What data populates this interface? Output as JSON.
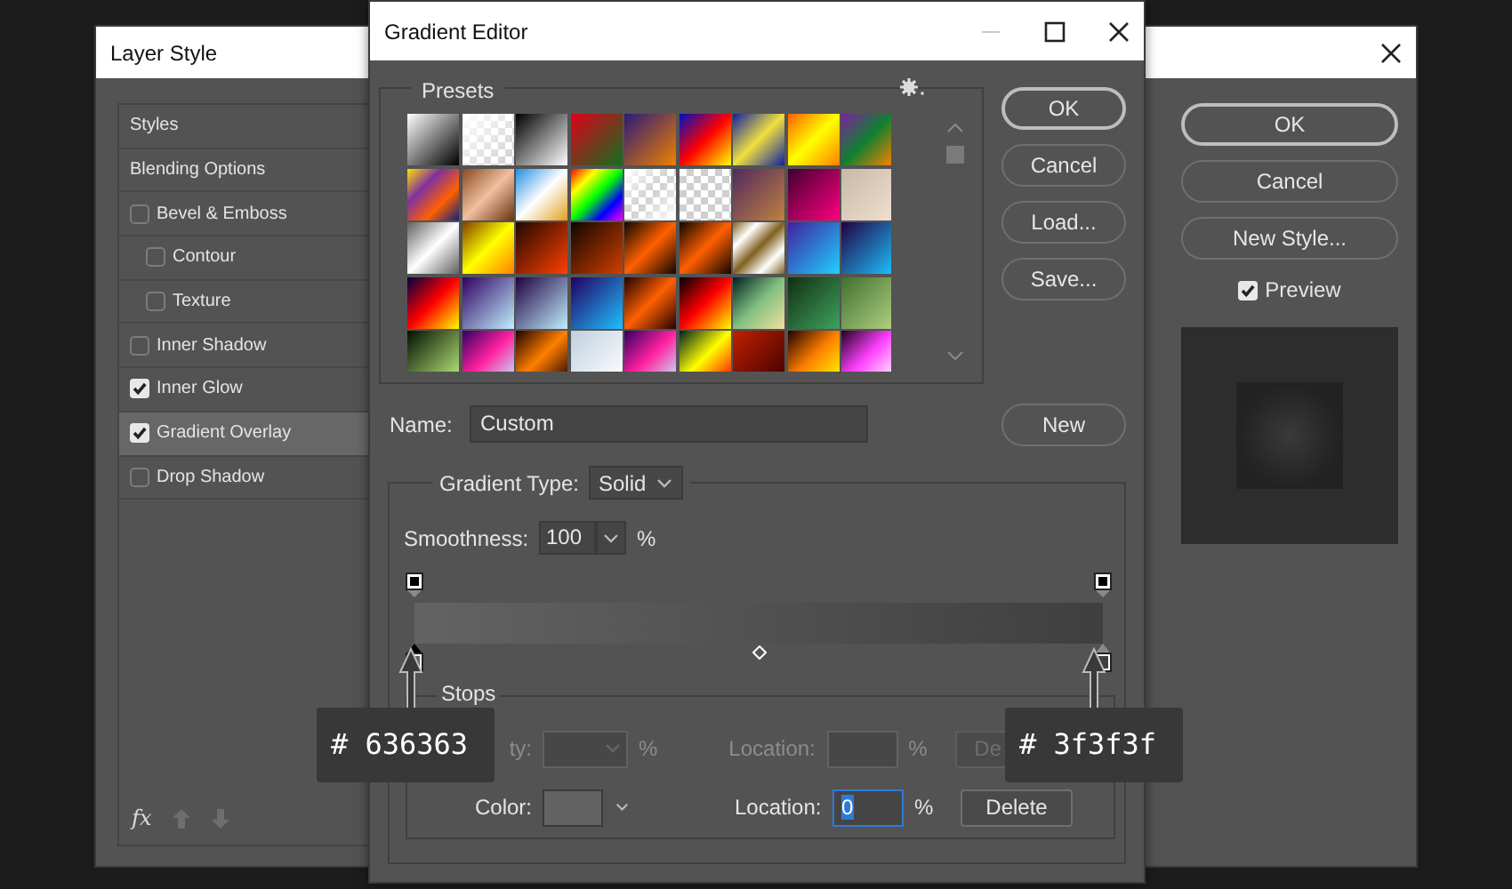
{
  "layer_style": {
    "title": "Layer Style",
    "items": [
      {
        "label": "Styles",
        "kind": "header",
        "selected": false
      },
      {
        "label": "Blending Options",
        "kind": "header",
        "selected": false
      },
      {
        "label": "Bevel & Emboss",
        "kind": "check",
        "checked": false,
        "selected": false,
        "children": [
          {
            "label": "Contour",
            "kind": "check",
            "checked": false,
            "selected": false
          },
          {
            "label": "Texture",
            "kind": "check",
            "checked": false,
            "selected": false
          }
        ]
      },
      {
        "label": "Inner Shadow",
        "kind": "check",
        "checked": false,
        "selected": false
      },
      {
        "label": "Inner Glow",
        "kind": "check",
        "checked": true,
        "selected": false
      },
      {
        "label": "Gradient Overlay",
        "kind": "check",
        "checked": true,
        "selected": true
      },
      {
        "label": "Drop Shadow",
        "kind": "check",
        "checked": false,
        "selected": false
      }
    ],
    "fx": "fx",
    "buttons": [
      {
        "label": "OK",
        "default": true
      },
      {
        "label": "Cancel",
        "default": false
      },
      {
        "label": "New Style...",
        "default": false
      }
    ],
    "preview": {
      "label": "Preview",
      "checked": true
    }
  },
  "gradient_editor": {
    "title": "Gradient Editor",
    "presets_label": "Presets",
    "buttons": [
      {
        "label": "OK",
        "default": true
      },
      {
        "label": "Cancel",
        "default": false
      },
      {
        "label": "Load...",
        "default": false
      },
      {
        "label": "Save...",
        "default": false
      }
    ],
    "name_label": "Name:",
    "name_value": "Custom",
    "new_button": "New",
    "gradient_type_label": "Gradient Type:",
    "gradient_type_value": "Solid",
    "smoothness_label": "Smoothness:",
    "smoothness_value": "100",
    "smoothness_unit": "%",
    "opacity_stops": [
      {
        "level": 0
      },
      {
        "level": 1
      }
    ],
    "color_stops": [
      {
        "level": 0,
        "color": "#636363",
        "selected": true
      },
      {
        "level": 1,
        "color": "#3f3f3f",
        "selected": false
      }
    ],
    "midpoint": {
      "level": 0.5
    },
    "stops_label": "Stops",
    "opacity_row": {
      "label": "ty:",
      "unit": "%",
      "location_label": "Location:",
      "location_unit": "%",
      "button": "De",
      "disabled": true
    },
    "color_row": {
      "label": "Color:",
      "color": "#636363",
      "location_label": "Location:",
      "location_value": "0",
      "location_unit": "%",
      "button": "Delete",
      "disabled": false
    }
  },
  "callouts": [
    {
      "text": "# 636363"
    },
    {
      "text": "# 3f3f3f"
    }
  ]
}
